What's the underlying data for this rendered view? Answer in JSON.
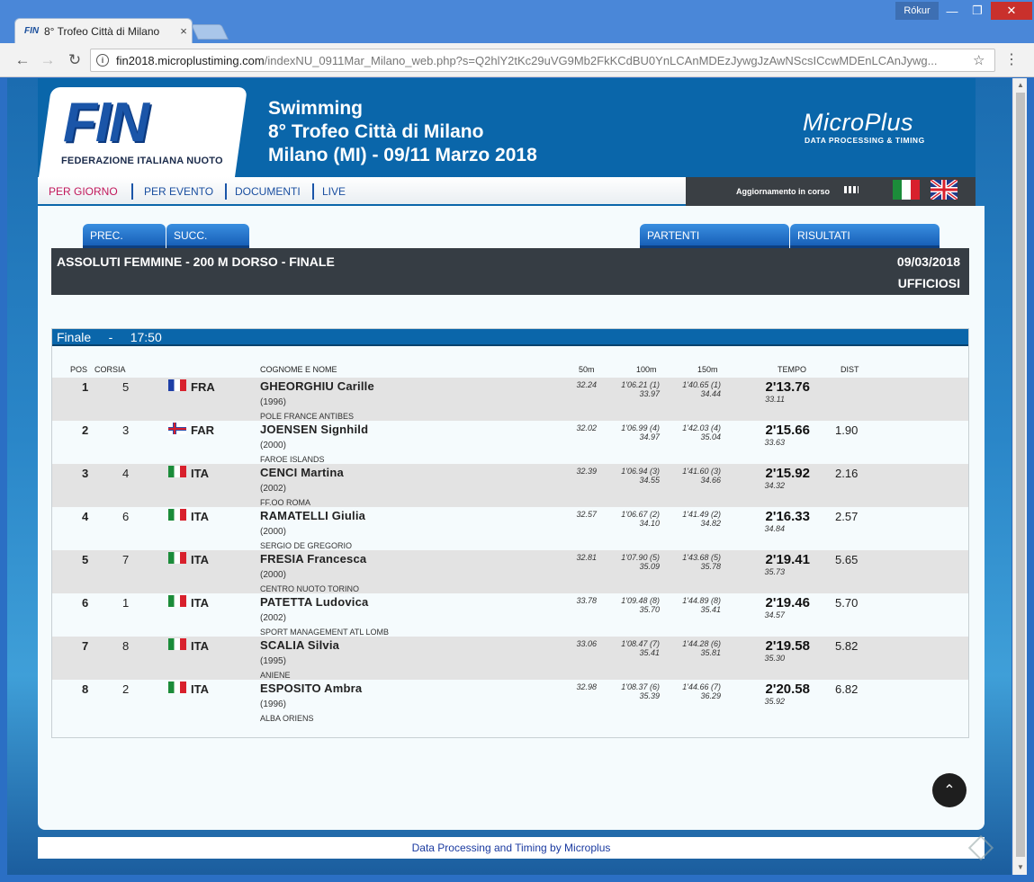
{
  "browser": {
    "tab_title": "8° Trofeo Città di Milano",
    "tab_favicon": "FIN",
    "tab_close": "×",
    "window_user": "Rókur",
    "win_min": "—",
    "win_max": "❐",
    "win_close": "✕",
    "back_icon": "←",
    "forward_icon": "→",
    "reload_icon": "↻",
    "info_icon": "i",
    "url_host": "fin2018.microplustiming.com",
    "url_path": "/indexNU_0911Mar_Milano_web.php?s=Q2hlY2tKc29uVG9Mb2FkKCdBU0YnLCAnMDEzJywgJzAwNScsICcwMDEnLCAnJywg...",
    "star_icon": "☆",
    "menu_icon": "⋮",
    "scroll_up": "▲",
    "scroll_down": "▼"
  },
  "header": {
    "logo_text": "FIN",
    "logo_subtitle": "FEDERAZIONE ITALIANA NUOTO",
    "sport": "Swimming",
    "event_name": "8° Trofeo Città di Milano",
    "place_dates": "Milano (MI) - 09/11 Marzo 2018",
    "partner_logo": "MicroPlus",
    "partner_tagline": "DATA PROCESSING & TIMING"
  },
  "nav": {
    "per_giorno": "PER GIORNO",
    "per_evento": "PER EVENTO",
    "documenti": "DOCUMENTI",
    "live": "LIVE",
    "status": "Aggiornamento in corso"
  },
  "tabs": {
    "prev": "PREC.",
    "next": "SUCC.",
    "starters": "PARTENTI",
    "results": "RISULTATI"
  },
  "event": {
    "title": "ASSOLUTI FEMMINE - 200 M DORSO - FINALE",
    "date": "09/03/2018",
    "status": "UFFICIOSI"
  },
  "heat": {
    "label": "Finale",
    "separator": "-",
    "time": "17:50"
  },
  "columns": {
    "pos": "POS",
    "lane": "CORSIA",
    "name": "COGNOME E NOME",
    "s50": "50m",
    "s100": "100m",
    "s150": "150m",
    "time": "TEMPO",
    "dist": "DIST"
  },
  "results": [
    {
      "pos": "1",
      "lane": "5",
      "nat": "FRA",
      "flag": "fr",
      "name": "GHEORGHIU Carille",
      "year": "(1996)",
      "club": "POLE FRANCE ANTIBES",
      "s50": "32.24",
      "s100": "1'06.21 (1)",
      "s100_lap": "33.97",
      "s150": "1'40.65 (1)",
      "s150_lap": "34.44",
      "time": "2'13.76",
      "time_lap": "33.11",
      "dist": ""
    },
    {
      "pos": "2",
      "lane": "3",
      "nat": "FAR",
      "flag": "fo",
      "name": "JOENSEN Signhild",
      "year": "(2000)",
      "club": "FAROE ISLANDS",
      "s50": "32.02",
      "s100": "1'06.99 (4)",
      "s100_lap": "34.97",
      "s150": "1'42.03 (4)",
      "s150_lap": "35.04",
      "time": "2'15.66",
      "time_lap": "33.63",
      "dist": "1.90"
    },
    {
      "pos": "3",
      "lane": "4",
      "nat": "ITA",
      "flag": "it",
      "name": "CENCI Martina",
      "year": "(2002)",
      "club": "FF.OO ROMA",
      "s50": "32.39",
      "s100": "1'06.94 (3)",
      "s100_lap": "34.55",
      "s150": "1'41.60 (3)",
      "s150_lap": "34.66",
      "time": "2'15.92",
      "time_lap": "34.32",
      "dist": "2.16"
    },
    {
      "pos": "4",
      "lane": "6",
      "nat": "ITA",
      "flag": "it",
      "name": "RAMATELLI Giulia",
      "year": "(2000)",
      "club": "SERGIO DE GREGORIO",
      "s50": "32.57",
      "s100": "1'06.67 (2)",
      "s100_lap": "34.10",
      "s150": "1'41.49 (2)",
      "s150_lap": "34.82",
      "time": "2'16.33",
      "time_lap": "34.84",
      "dist": "2.57"
    },
    {
      "pos": "5",
      "lane": "7",
      "nat": "ITA",
      "flag": "it",
      "name": "FRESIA Francesca",
      "year": "(2000)",
      "club": "CENTRO NUOTO TORINO",
      "s50": "32.81",
      "s100": "1'07.90 (5)",
      "s100_lap": "35.09",
      "s150": "1'43.68 (5)",
      "s150_lap": "35.78",
      "time": "2'19.41",
      "time_lap": "35.73",
      "dist": "5.65"
    },
    {
      "pos": "6",
      "lane": "1",
      "nat": "ITA",
      "flag": "it",
      "name": "PATETTA Ludovica",
      "year": "(2002)",
      "club": "SPORT MANAGEMENT ATL LOMB",
      "s50": "33.78",
      "s100": "1'09.48 (8)",
      "s100_lap": "35.70",
      "s150": "1'44.89 (8)",
      "s150_lap": "35.41",
      "time": "2'19.46",
      "time_lap": "34.57",
      "dist": "5.70"
    },
    {
      "pos": "7",
      "lane": "8",
      "nat": "ITA",
      "flag": "it",
      "name": "SCALIA Silvia",
      "year": "(1995)",
      "club": "ANIENE",
      "s50": "33.06",
      "s100": "1'08.47 (7)",
      "s100_lap": "35.41",
      "s150": "1'44.28 (6)",
      "s150_lap": "35.81",
      "time": "2'19.58",
      "time_lap": "35.30",
      "dist": "5.82"
    },
    {
      "pos": "8",
      "lane": "2",
      "nat": "ITA",
      "flag": "it",
      "name": "ESPOSITO Ambra",
      "year": "(1996)",
      "club": "ALBA ORIENS",
      "s50": "32.98",
      "s100": "1'08.37 (6)",
      "s100_lap": "35.39",
      "s150": "1'44.66 (7)",
      "s150_lap": "36.29",
      "time": "2'20.58",
      "time_lap": "35.92",
      "dist": "6.82"
    }
  ],
  "scroll_top_icon": "⌃",
  "footer": "Data Processing and Timing by Microplus",
  "colors": {
    "header_blue": "#0a66aa",
    "event_bar": "#363d44",
    "nav_active": "#c2185b"
  }
}
